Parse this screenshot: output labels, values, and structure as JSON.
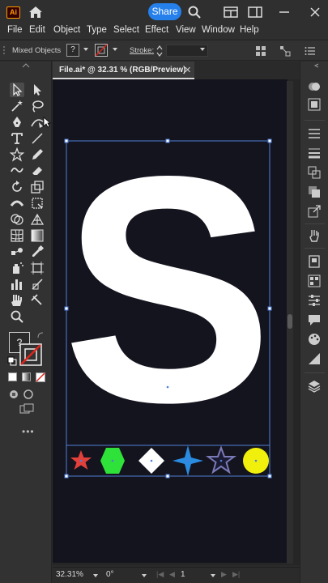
{
  "app": {
    "logo_text": "Ai",
    "share_label": "Share"
  },
  "menu": {
    "items": [
      "File",
      "Edit",
      "Object",
      "Type",
      "Select",
      "Effect",
      "View",
      "Window",
      "Help"
    ]
  },
  "control": {
    "selection_label": "Mixed Objects",
    "fill_box": "?",
    "stroke_label": "Stroke:"
  },
  "document": {
    "tab_label": "File.ai* @ 32.31 % (RGB/Preview)",
    "close_glyph": "✕"
  },
  "artwork": {
    "letter": "S",
    "shape_colors": [
      "#e2403a",
      "#2ee23a",
      "#ffffff",
      "#2a8ce0",
      "#1a1a33",
      "#f0f00c"
    ],
    "shape_names": [
      "star-red",
      "hexagon-green",
      "diamond-white",
      "four-point-star-blue",
      "star-outline-purple",
      "circle-yellow"
    ]
  },
  "status": {
    "zoom": "32.31%",
    "rotation": "0°",
    "artboard_number": "1"
  },
  "colors": {
    "accent": "#2680eb",
    "selection": "#4f7fd6",
    "artboard_bg": "#14141f"
  }
}
